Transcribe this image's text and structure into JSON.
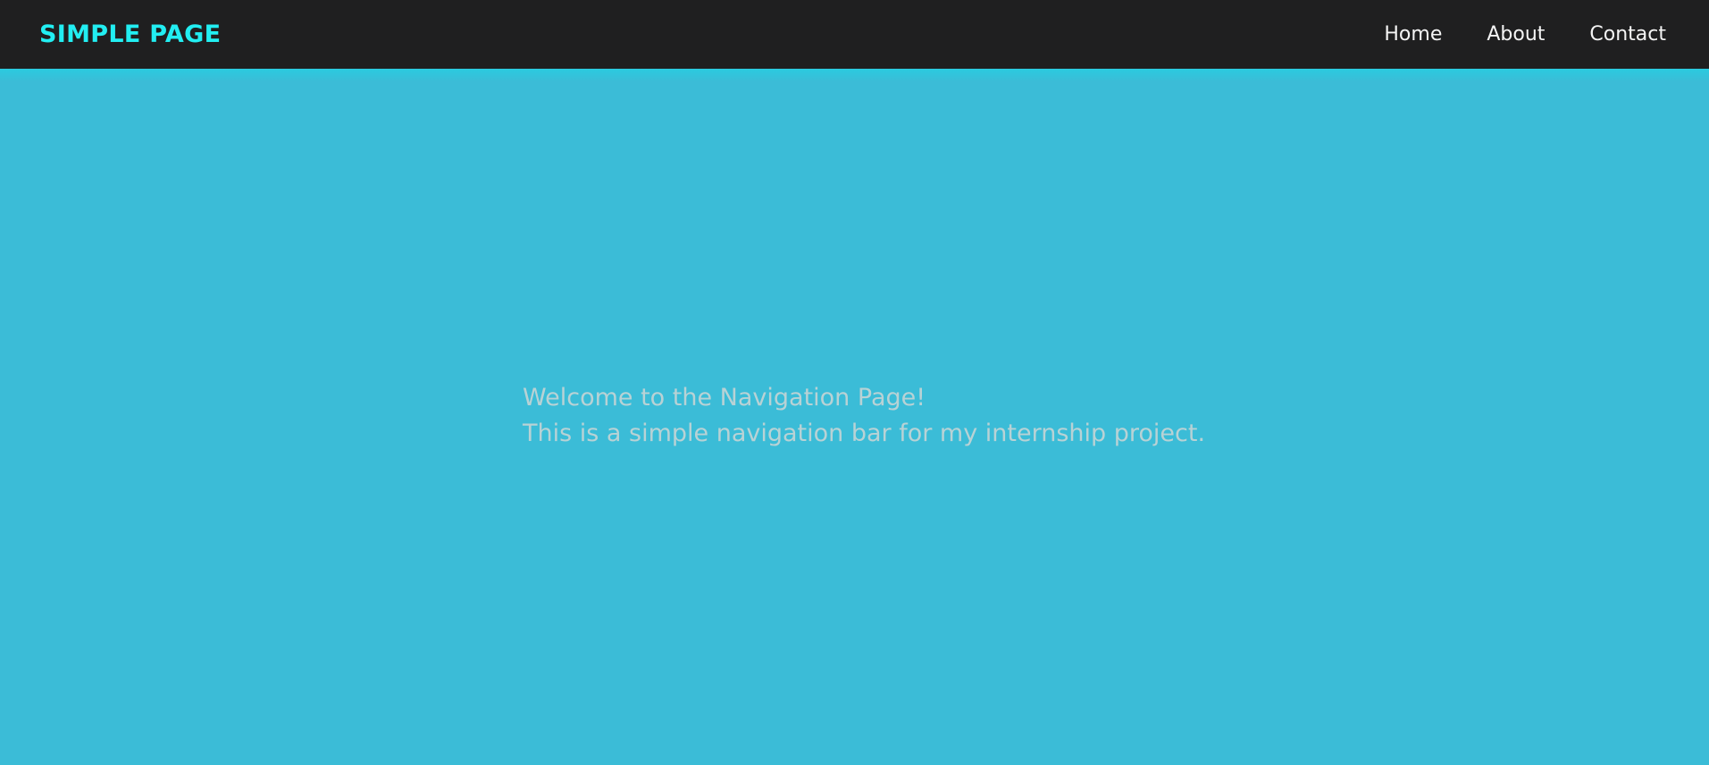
{
  "navbar": {
    "brand": "SIMPLE PAGE",
    "links": [
      {
        "label": "Home"
      },
      {
        "label": "About"
      },
      {
        "label": "Contact"
      }
    ]
  },
  "hero": {
    "line1": "Welcome to the Navigation Page!",
    "line2": "This is a simple navigation bar for my internship project."
  },
  "colors": {
    "background": "#3bbcd7",
    "navbar_background": "#1f1f20",
    "brand": "#22eef2",
    "nav_link": "#f4f4f4",
    "hero_text": "#b8d2d5"
  }
}
